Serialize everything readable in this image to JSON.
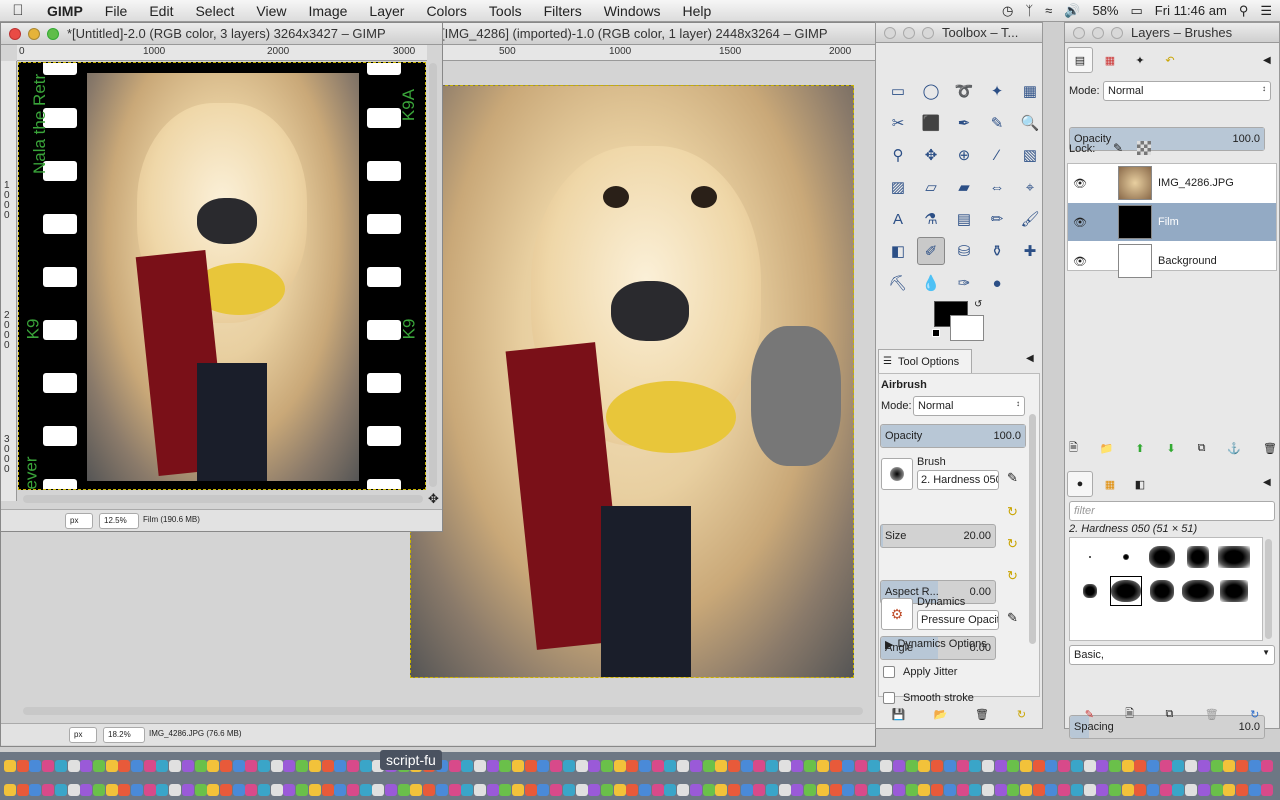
{
  "menubar": {
    "app_name": "GIMP",
    "items": [
      "File",
      "Edit",
      "Select",
      "View",
      "Image",
      "Layer",
      "Colors",
      "Tools",
      "Filters",
      "Windows",
      "Help"
    ],
    "battery": "58%",
    "clock": "Fri 11:46 am"
  },
  "window_film": {
    "title": "*[Untitled]-2.0 (RGB color, 3 layers) 3264x3427 – GIMP",
    "ruler_ticks": [
      "0",
      "1000",
      "2000",
      "3000"
    ],
    "vruler_labels": [
      "1000",
      "2000",
      "3000"
    ],
    "film_text_top": "Nala the Retr",
    "film_text_right_top": "K9A",
    "film_text_left_mid": "K9",
    "film_text_right_mid": "K9",
    "film_text_bottom": "ever",
    "unit": "px",
    "zoom": "12.5%",
    "status": "Film (190.6 MB)"
  },
  "window_photo": {
    "title": "[IMG_4286] (imported)-1.0 (RGB color, 1 layer) 2448x3264 – GIMP",
    "ruler_ticks": [
      "500",
      "1000",
      "1500",
      "2000"
    ],
    "unit": "px",
    "zoom": "18.2%",
    "status": "IMG_4286.JPG (76.6 MB)"
  },
  "toolbox": {
    "title": "Toolbox – T...",
    "fg_color": "#000000",
    "bg_color": "#ffffff",
    "tab_label": "Tool Options",
    "tool_name": "Airbrush",
    "mode_label": "Mode:",
    "mode_value": "Normal",
    "opacity_label": "Opacity",
    "opacity_value": "100.0",
    "brush_label": "Brush",
    "brush_value": "2. Hardness 050",
    "size_label": "Size",
    "size_value": "20.00",
    "size_fill": 0.02,
    "aspect_label": "Aspect R...",
    "aspect_value": "0.00",
    "aspect_fill": 0.5,
    "angle_label": "Angle",
    "angle_value": "0.00",
    "angle_fill": 0.5,
    "dynamics_label": "Dynamics",
    "dynamics_value": "Pressure Opacity",
    "dynamics_options": "Dynamics Options",
    "apply_jitter": "Apply Jitter",
    "smooth_stroke": "Smooth stroke"
  },
  "layers": {
    "title": "Layers – Brushes",
    "mode_label": "Mode:",
    "mode_value": "Normal",
    "opacity_label": "Opacity",
    "opacity_value": "100.0",
    "lock_label": "Lock:",
    "items": [
      {
        "name": "IMG_4286.JPG",
        "selected": false
      },
      {
        "name": "Film",
        "selected": true
      },
      {
        "name": "Background",
        "selected": false
      }
    ],
    "filter_placeholder": "filter",
    "brush_caption": "2. Hardness 050 (51 × 51)",
    "brush_set": "Basic,",
    "spacing_label": "Spacing",
    "spacing_value": "10.0"
  },
  "dock": {
    "tooltip": "script-fu"
  },
  "colors": {
    "selection": "#93aac4",
    "film_text": "#3aa53a"
  }
}
